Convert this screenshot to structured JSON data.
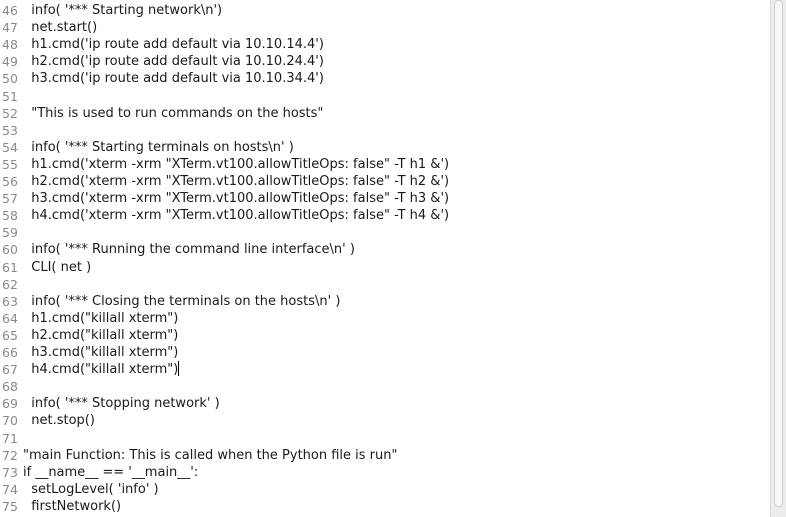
{
  "editor": {
    "lines": [
      {
        "n": "46",
        "t": "  info( '*** Starting network\\n')"
      },
      {
        "n": "47",
        "t": "  net.start()"
      },
      {
        "n": "48",
        "t": "  h1.cmd('ip route add default via 10.10.14.4')"
      },
      {
        "n": "49",
        "t": "  h2.cmd('ip route add default via 10.10.24.4')"
      },
      {
        "n": "50",
        "t": "  h3.cmd('ip route add default via 10.10.34.4')"
      },
      {
        "n": "51",
        "t": ""
      },
      {
        "n": "52",
        "t": "  \"This is used to run commands on the hosts\""
      },
      {
        "n": "53",
        "t": ""
      },
      {
        "n": "54",
        "t": "  info( '*** Starting terminals on hosts\\n' )"
      },
      {
        "n": "55",
        "t": "  h1.cmd('xterm -xrm \"XTerm.vt100.allowTitleOps: false\" -T h1 &')"
      },
      {
        "n": "56",
        "t": "  h2.cmd('xterm -xrm \"XTerm.vt100.allowTitleOps: false\" -T h2 &')"
      },
      {
        "n": "57",
        "t": "  h3.cmd('xterm -xrm \"XTerm.vt100.allowTitleOps: false\" -T h3 &')"
      },
      {
        "n": "58",
        "t": "  h4.cmd('xterm -xrm \"XTerm.vt100.allowTitleOps: false\" -T h4 &')"
      },
      {
        "n": "59",
        "t": ""
      },
      {
        "n": "60",
        "t": "  info( '*** Running the command line interface\\n' )"
      },
      {
        "n": "61",
        "t": "  CLI( net )"
      },
      {
        "n": "62",
        "t": ""
      },
      {
        "n": "63",
        "t": "  info( '*** Closing the terminals on the hosts\\n' )"
      },
      {
        "n": "64",
        "t": "  h1.cmd(\"killall xterm\")"
      },
      {
        "n": "65",
        "t": "  h2.cmd(\"killall xterm\")"
      },
      {
        "n": "66",
        "t": "  h3.cmd(\"killall xterm\")"
      },
      {
        "n": "67",
        "t": "  h4.cmd(\"killall xterm\")",
        "cursor": true
      },
      {
        "n": "68",
        "t": ""
      },
      {
        "n": "69",
        "t": "  info( '*** Stopping network' )"
      },
      {
        "n": "70",
        "t": "  net.stop()"
      },
      {
        "n": "71",
        "t": ""
      },
      {
        "n": "72",
        "t": "\"main Function: This is called when the Python file is run\""
      },
      {
        "n": "73",
        "t": "if __name__ == '__main__':"
      },
      {
        "n": "74",
        "t": "  setLogLevel( 'info' )"
      },
      {
        "n": "75",
        "t": "  firstNetwork()"
      }
    ]
  }
}
